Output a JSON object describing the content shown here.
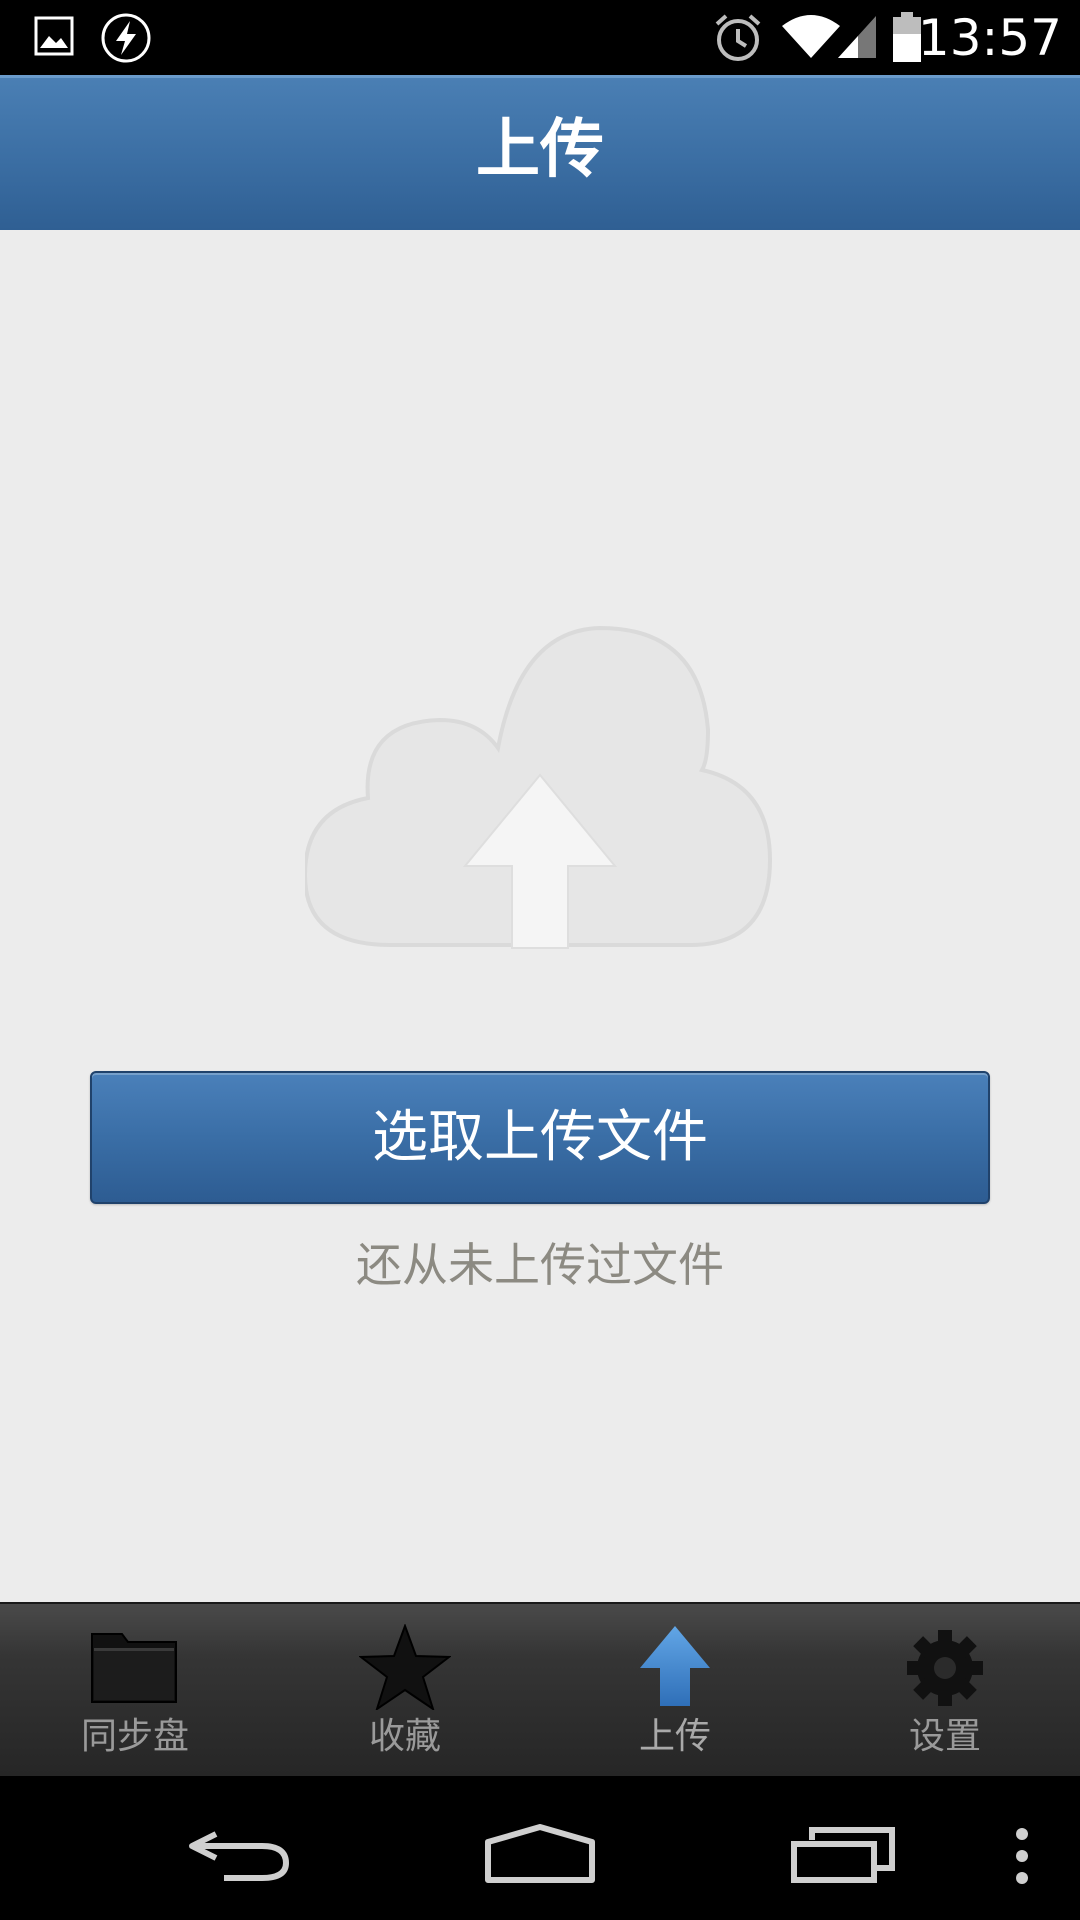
{
  "status_bar": {
    "time": "13:57",
    "icons": [
      "image-notification-icon",
      "flash-notification-icon",
      "alarm-icon",
      "wifi-icon",
      "signal-icon",
      "battery-icon"
    ]
  },
  "header": {
    "title": "上传"
  },
  "main": {
    "illustration": "cloud-upload-icon",
    "upload_button_label": "选取上传文件",
    "empty_message": "还从未上传过文件"
  },
  "tabs": [
    {
      "label": "同步盘",
      "icon": "folder-icon",
      "active": false
    },
    {
      "label": "收藏",
      "icon": "star-icon",
      "active": false
    },
    {
      "label": "上传",
      "icon": "upload-arrow-icon",
      "active": true
    },
    {
      "label": "设置",
      "icon": "gear-icon",
      "active": false
    }
  ],
  "nav_bar": {
    "buttons": [
      "back-icon",
      "home-icon",
      "recent-apps-icon",
      "menu-icon"
    ]
  },
  "colors": {
    "accent": "#3b6ea3",
    "content_background": "#ececec",
    "tab_bar": "#2c2c2c",
    "active_tab_icon": "#3a7dc6",
    "inactive_tab_label": "#9a9a9a",
    "empty_text": "#8c8a82"
  }
}
